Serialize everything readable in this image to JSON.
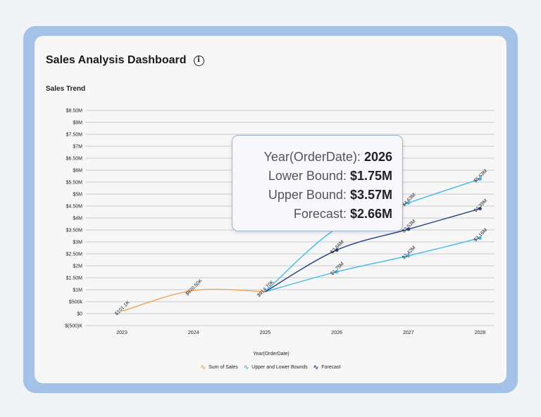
{
  "dashboard": {
    "title": "Sales Analysis Dashboard",
    "info_icon": "info-icon"
  },
  "tooltip": {
    "year_label": "Year(OrderDate):",
    "year_value": "2026",
    "lower_label": "Lower Bound:",
    "lower_value": "$1.75M",
    "upper_label": "Upper Bound:",
    "upper_value": "$3.57M",
    "forecast_label": "Forecast:",
    "forecast_value": "$2.66M"
  },
  "colors": {
    "sales": "#f3a352",
    "bounds": "#3fb9ee",
    "forecast": "#233f83",
    "grid": "#c9c9c9"
  },
  "chart_data": {
    "type": "line",
    "title": "Sales Trend",
    "xlabel": "Year(OrderDate)",
    "ylabel": "",
    "categories": [
      "2023",
      "2024",
      "2025",
      "2026",
      "2027",
      "2028"
    ],
    "ylim": [
      -0.5,
      8.5
    ],
    "yticks": [
      -0.5,
      0,
      0.5,
      1,
      1.5,
      2,
      2.5,
      3,
      3.5,
      4,
      4.5,
      5,
      5.5,
      6,
      6.5,
      7,
      7.5,
      8,
      8.5
    ],
    "ytick_labels": [
      "$(500)K",
      "$0",
      "$500k",
      "$1M",
      "$1.50M",
      "$2M",
      "$2.50M",
      "$3M",
      "$3.50M",
      "$4M",
      "$4.50M",
      "$5M",
      "$5.50M",
      "$6M",
      "$6.50M",
      "$7M",
      "$7.50M",
      "$8M",
      "$8.50M"
    ],
    "grid": true,
    "legend": "bottom-center",
    "series": [
      {
        "name": "Sum of Sales",
        "key": "sales",
        "x": [
          "2023",
          "2024",
          "2025"
        ],
        "values": [
          0.1011,
          0.9705,
          0.9147
        ],
        "labels": [
          "$101.1K",
          "$970.50K",
          "$914.70K"
        ]
      },
      {
        "name": "Upper and Lower Bounds",
        "key": "upper",
        "x": [
          "2025",
          "2026",
          "2027",
          "2028"
        ],
        "values": [
          0.9147,
          3.57,
          4.63,
          5.63
        ],
        "labels": [
          "",
          "",
          "$4.63M",
          "$5.63M"
        ]
      },
      {
        "name": "Upper and Lower Bounds",
        "key": "lower",
        "x": [
          "2025",
          "2026",
          "2027",
          "2028"
        ],
        "values": [
          0.9147,
          1.75,
          2.42,
          3.16
        ],
        "labels": [
          "",
          "$1.75M",
          "$2.42M",
          "$3.16M"
        ]
      },
      {
        "name": "Forecast",
        "key": "forecast",
        "x": [
          "2025",
          "2026",
          "2027",
          "2028"
        ],
        "values": [
          0.9147,
          2.66,
          3.53,
          4.39
        ],
        "labels": [
          "",
          "$2.66M",
          "$3.53M",
          "$4.39M"
        ]
      }
    ],
    "legend_items": [
      {
        "label": "Sum of Sales",
        "key": "sales"
      },
      {
        "label": "Upper and Lower Bounds",
        "key": "bounds"
      },
      {
        "label": "Forecast",
        "key": "forecast"
      }
    ]
  }
}
